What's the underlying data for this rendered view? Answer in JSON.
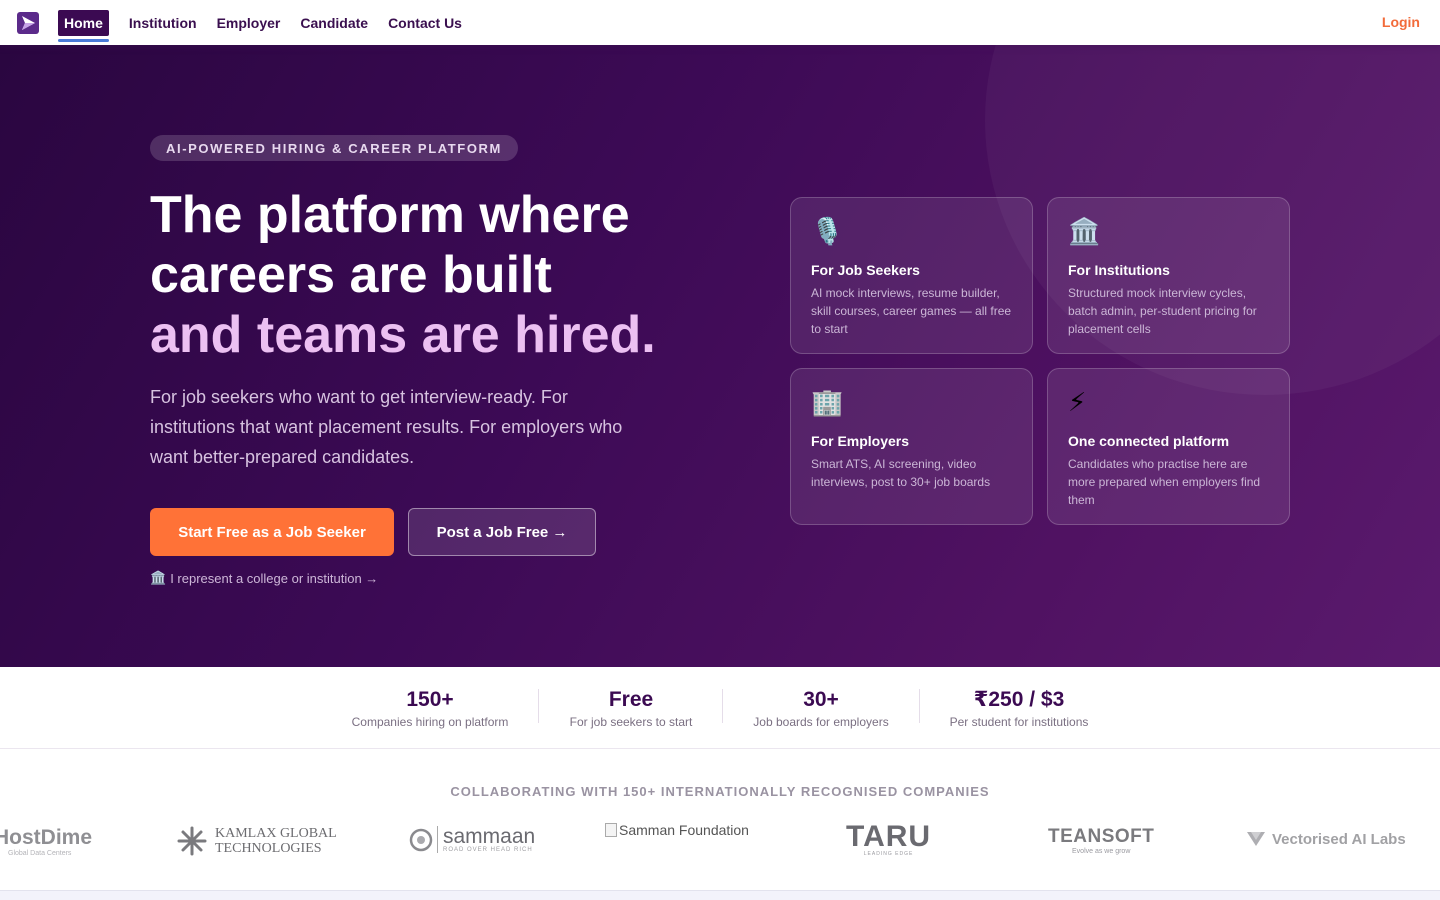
{
  "nav": {
    "links": [
      {
        "label": "Home"
      },
      {
        "label": "Institution"
      },
      {
        "label": "Employer"
      },
      {
        "label": "Candidate"
      },
      {
        "label": "Contact Us"
      }
    ],
    "login": "Login"
  },
  "hero": {
    "badge": "AI-POWERED HIRING & CAREER PLATFORM",
    "headline_line1": "The platform where",
    "headline_line2": "careers are built",
    "headline_accent": "and teams are hired.",
    "subtext": "For job seekers who want to get interview-ready. For institutions that want placement results. For employers who want better-prepared candidates.",
    "primary_cta": "Start Free as a Job Seeker",
    "secondary_cta": "Post a Job Free →",
    "college_icon": "🏛️",
    "college_link": "I represent a college or institution →"
  },
  "cards": [
    {
      "icon": "🎙️",
      "icon_name": "microphone-icon",
      "title": "For Job Seekers",
      "desc": "AI mock interviews, resume builder, skill courses, career games — all free to start"
    },
    {
      "icon": "🏛️",
      "icon_name": "institution-icon",
      "title": "For Institutions",
      "desc": "Structured mock interview cycles, batch admin, per-student pricing for placement cells"
    },
    {
      "icon": "🏢",
      "icon_name": "office-building-icon",
      "title": "For Employers",
      "desc": "Smart ATS, AI screening, video interviews, post to 30+ job boards"
    },
    {
      "icon": "⚡",
      "icon_name": "lightning-icon",
      "title": "One connected platform",
      "desc": "Candidates who practise here are more prepared when employers find them"
    }
  ],
  "stats": [
    {
      "value": "150+",
      "label": "Companies hiring on platform"
    },
    {
      "value": "Free",
      "label": "For job seekers to start"
    },
    {
      "value": "30+",
      "label": "Job boards for employers"
    },
    {
      "value": "₹250 / $3",
      "label": "Per student for institutions"
    }
  ],
  "collab": {
    "title": "COLLABORATING WITH 150+ INTERNATIONALLY RECOGNISED COMPANIES",
    "logos": [
      {
        "name": "HostDime",
        "tagline": "Global Data Centers"
      },
      {
        "name": "KAMLAX GLOBAL",
        "name2": "TECHNOLOGIES"
      },
      {
        "name": "sammaan",
        "tagline": "ROAD OVER HEAD RICH"
      },
      {
        "name": "Samman Foundation"
      },
      {
        "name": "TARU",
        "tagline": "LEADING EDGE"
      },
      {
        "name": "TEANSOFT",
        "tagline": "Evolve as we grow"
      },
      {
        "name": "Vectorised AI Labs"
      }
    ]
  },
  "colors": {
    "brand_purple": "#3b0a52",
    "accent_orange": "#ff7237",
    "accent_pink": "#ecc0f2"
  }
}
